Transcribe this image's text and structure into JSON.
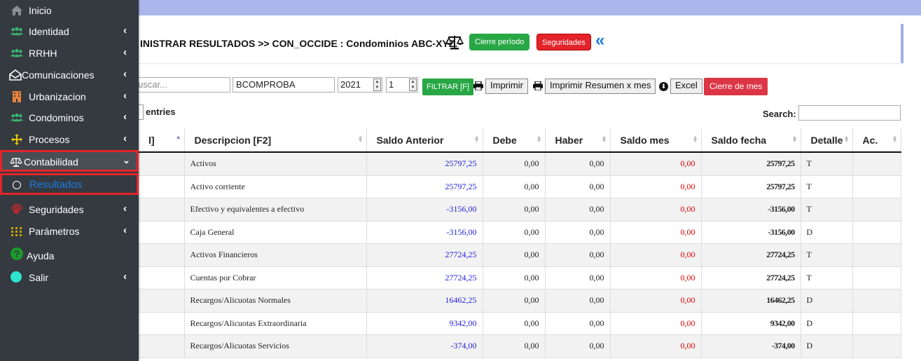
{
  "header": {
    "title": "INISTRAR RESULTADOS >> CON_OCCIDE : Condominios ABC-XYZ.",
    "cierre_periodo": "Cierre período",
    "seguridades": "Seguridades",
    "collapse_icon": "double-chevron-left-icon"
  },
  "toolbar": {
    "search_placeholder": "uscar...",
    "account_value": "BCOMPROBA",
    "year": "2021",
    "month": "1",
    "filtrar": "FILTRAR [F]",
    "imprimir": "Imprimir",
    "imprimir_resumen": "Imprimir Resumen x mes",
    "excel": "Excel",
    "cierre_mes": "Cierre de mes"
  },
  "table_controls": {
    "entries_label": "entries",
    "search_label": "Search:"
  },
  "table": {
    "headers": [
      "l]",
      "Descripcion [F2]",
      "Saldo Anterior",
      "Debe",
      "Haber",
      "Saldo mes",
      "Saldo fecha",
      "Detalle",
      "Ac."
    ],
    "rows": [
      {
        "desc": "Activos",
        "anterior": "25797,25",
        "debe": "0,00",
        "haber": "0,00",
        "mes": "0,00",
        "fecha": "25797,25",
        "detalle": "T"
      },
      {
        "desc": "Activo corriente",
        "anterior": "25797,25",
        "debe": "0,00",
        "haber": "0,00",
        "mes": "0,00",
        "fecha": "25797,25",
        "detalle": "T"
      },
      {
        "desc": "Efectivo y equivalentes a efectivo",
        "anterior": "-3156,00",
        "debe": "0,00",
        "haber": "0,00",
        "mes": "0,00",
        "fecha": "-3156,00",
        "detalle": "T"
      },
      {
        "desc": "Caja General",
        "anterior": "-3156,00",
        "debe": "0,00",
        "haber": "0,00",
        "mes": "0,00",
        "fecha": "-3156,00",
        "detalle": "D"
      },
      {
        "desc": "Activos Financieros",
        "anterior": "27724,25",
        "debe": "0,00",
        "haber": "0,00",
        "mes": "0,00",
        "fecha": "27724,25",
        "detalle": "T"
      },
      {
        "desc": "Cuentas por Cobrar",
        "anterior": "27724,25",
        "debe": "0,00",
        "haber": "0,00",
        "mes": "0,00",
        "fecha": "27724,25",
        "detalle": "T"
      },
      {
        "desc": "Recargos/Alicuotas Normales",
        "anterior": "16462,25",
        "debe": "0,00",
        "haber": "0,00",
        "mes": "0,00",
        "fecha": "16462,25",
        "detalle": "D"
      },
      {
        "desc": "Recargos/Alicuotas Extraordinaria",
        "anterior": "9342,00",
        "debe": "0,00",
        "haber": "0,00",
        "mes": "0,00",
        "fecha": "9342,00",
        "detalle": "D"
      },
      {
        "desc": "Recargos/Alicuotas Servicios",
        "anterior": "-374,00",
        "debe": "0,00",
        "haber": "0,00",
        "mes": "0,00",
        "fecha": "-374,00",
        "detalle": "D"
      }
    ]
  },
  "sidebar": {
    "items": [
      {
        "label": "Inicio",
        "icon": "home-icon"
      },
      {
        "label": "Identidad",
        "icon": "users-icon"
      },
      {
        "label": "RRHH",
        "icon": "users-icon"
      },
      {
        "label": "Comunicaciones",
        "icon": "envelope-open-icon"
      },
      {
        "label": "Urbanizacion",
        "icon": "building-icon"
      },
      {
        "label": "Condominos",
        "icon": "users-icon"
      },
      {
        "label": "Procesos",
        "icon": "arrows-icon"
      },
      {
        "label": "Contabilidad",
        "icon": "balance-scale-icon"
      },
      {
        "label": "Resultados",
        "icon": "circle-icon"
      },
      {
        "label": "Seguridades",
        "icon": "fingerprint-icon"
      },
      {
        "label": "Parámetros",
        "icon": "grid-dots-icon"
      },
      {
        "label": "Ayuda",
        "icon": "question-circle-icon"
      },
      {
        "label": "Salir",
        "icon": "circle-icon"
      }
    ]
  },
  "colors": {
    "sidebar_bg": "#343a40",
    "highlight_border": "#e3242b",
    "active_link": "#1a7ce0",
    "success": "#28a745",
    "danger": "#dc3545",
    "top_bar": "#a9b7ec"
  }
}
